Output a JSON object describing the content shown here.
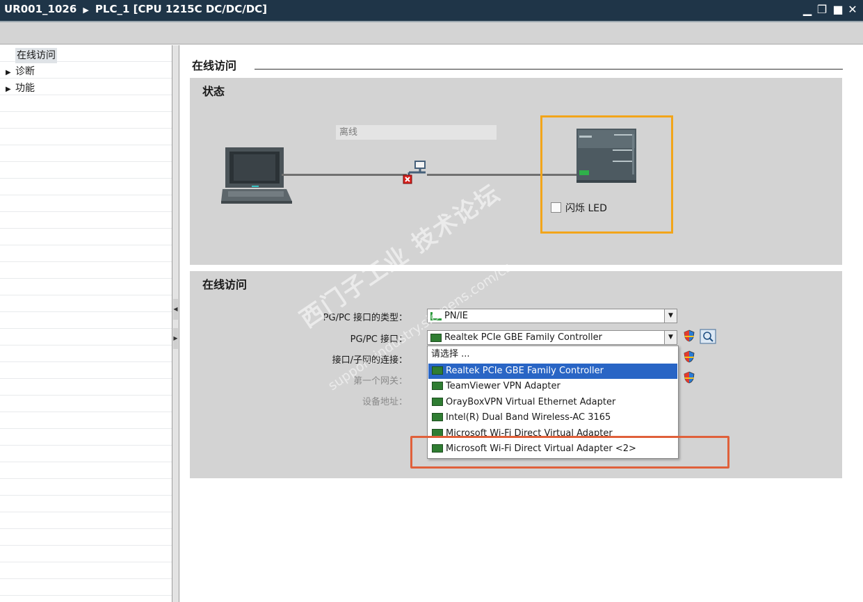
{
  "titlebar": {
    "project": "UR001_1026",
    "device": "PLC_1 [CPU 1215C DC/DC/DC]",
    "minimize": "▁",
    "restore": "❐",
    "maximize": "■",
    "close": "✕"
  },
  "nav": {
    "items": [
      {
        "label": "在线访问",
        "expandable": false,
        "selected": true
      },
      {
        "label": "诊断",
        "expandable": true
      },
      {
        "label": "功能",
        "expandable": true
      }
    ]
  },
  "main": {
    "title": "在线访问",
    "status_section": {
      "title": "状态",
      "connection_status": "离线",
      "flash_led_label": "闪烁 LED",
      "flash_led_checked": false
    },
    "online_section": {
      "title": "在线访问",
      "interface_type_label": "PG/PC 接口的类型：",
      "interface_type_value": "PN/IE",
      "interface_label": "PG/PC 接口：",
      "interface_value": "Realtek PCIe GBE Family Controller",
      "subnet_label": "接口/子网的连接：",
      "gateway_label": "第一个网关：",
      "address_label": "设备地址："
    },
    "dropdown": {
      "prompt": "请选择 ...",
      "options": [
        "Realtek PCIe GBE Family Controller",
        "TeamViewer VPN Adapter",
        "OrayBoxVPN Virtual Ethernet Adapter",
        "Intel(R) Dual Band Wireless-AC 3165",
        "Microsoft Wi-Fi Direct Virtual Adapter",
        "Microsoft Wi-Fi Direct Virtual Adapter <2>"
      ],
      "selected_index": 0
    }
  },
  "watermark": {
    "text": "西门子工业  技术论坛",
    "url": "support.industry.siemens.com/cs"
  },
  "colors": {
    "titlebar": "#1f3548",
    "cpu_frame": "#f2a51a",
    "highlight_box": "#e0603a",
    "selection": "#2965c5"
  }
}
